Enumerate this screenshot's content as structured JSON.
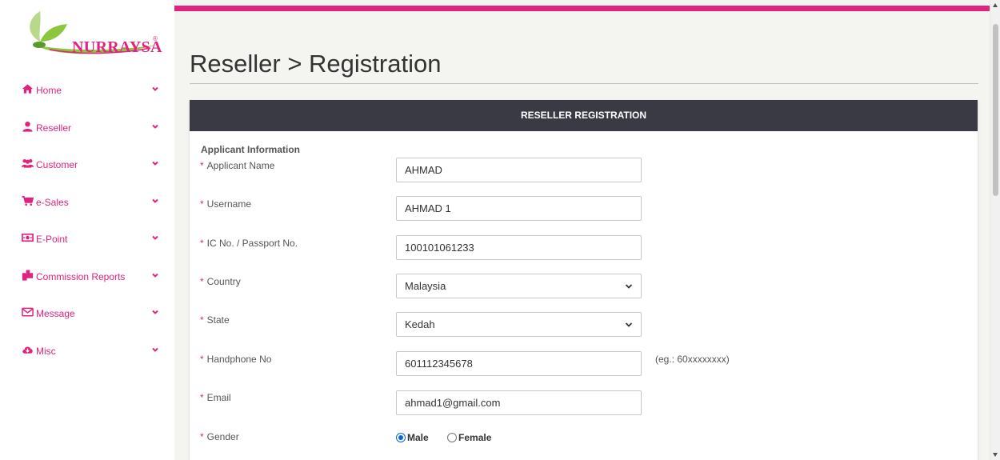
{
  "brand": {
    "name": "NURRAYSA",
    "mark": "®",
    "accent": "#e0237d",
    "leaf_color": "#8cc63f"
  },
  "sidebar": {
    "items": [
      {
        "label": "Home",
        "icon": "home-icon"
      },
      {
        "label": "Reseller",
        "icon": "user-icon"
      },
      {
        "label": "Customer",
        "icon": "users-icon"
      },
      {
        "label": "e-Sales",
        "icon": "cart-icon"
      },
      {
        "label": "E-Point",
        "icon": "money-icon"
      },
      {
        "label": "Commission Reports",
        "icon": "files-icon"
      },
      {
        "label": "Message",
        "icon": "envelope-icon"
      },
      {
        "label": "Misc",
        "icon": "cloud-download-icon"
      }
    ]
  },
  "page": {
    "title": "Reseller > Registration"
  },
  "panel": {
    "heading": "RESELLER REGISTRATION",
    "section": "Applicant Information",
    "required_mark": "*",
    "fields": {
      "applicant_name": {
        "label": "Applicant Name",
        "value": "AHMAD"
      },
      "username": {
        "label": "Username",
        "value": "AHMAD 1"
      },
      "ic_no": {
        "label": "IC No. / Passport No.",
        "value": "100101061233"
      },
      "country": {
        "label": "Country",
        "value": "Malaysia"
      },
      "state": {
        "label": "State",
        "value": "Kedah"
      },
      "handphone": {
        "label": "Handphone No",
        "value": "601112345678",
        "hint": "(eg.: 60xxxxxxxx)"
      },
      "email": {
        "label": "Email",
        "value": "ahmad1@gmail.com"
      },
      "gender": {
        "label": "Gender",
        "options": [
          "Male",
          "Female"
        ],
        "selected": "Male"
      }
    }
  },
  "colors": {
    "header_bg": "#3a3a44",
    "page_bg": "#f4f4f0"
  }
}
